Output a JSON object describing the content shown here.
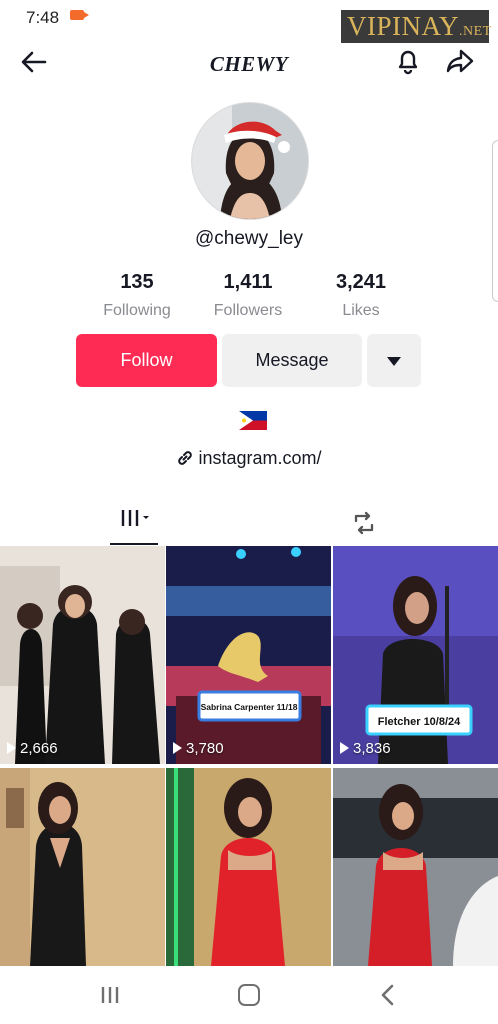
{
  "status_bar": {
    "time": "7:48"
  },
  "watermark": {
    "main": "VIPINAY",
    "suffix": ".NET"
  },
  "header": {
    "title": "CHEWY"
  },
  "profile": {
    "handle": "@chewy_ley",
    "stats": [
      {
        "value": "135",
        "label": "Following"
      },
      {
        "value": "1,411",
        "label": "Followers"
      },
      {
        "value": "3,241",
        "label": "Likes"
      }
    ],
    "follow_label": "Follow",
    "message_label": "Message",
    "link": "instagram.com/"
  },
  "videos": [
    {
      "views": "2,666",
      "caption": ""
    },
    {
      "views": "3,780",
      "caption": "Sabrina Carpenter 11/18"
    },
    {
      "views": "3,836",
      "caption": "Fletcher 10/8/24"
    },
    {
      "views": "",
      "caption": ""
    },
    {
      "views": "",
      "caption": ""
    },
    {
      "views": "",
      "caption": ""
    }
  ],
  "colors": {
    "accent": "#fe2c55",
    "secondary_button": "#f0f0f1",
    "text": "#161823",
    "muted": "#8a8b91"
  }
}
